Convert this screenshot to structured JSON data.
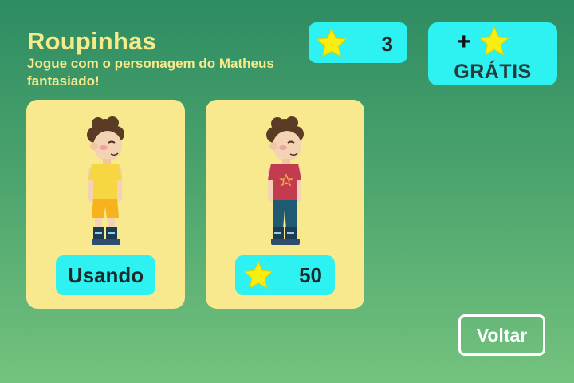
{
  "header": {
    "title": "Roupinhas",
    "subtitle": "Jogue com o personagem do Matheus fantasiado!"
  },
  "stars": {
    "count": "3",
    "icon": "star-icon"
  },
  "free_stars": {
    "plus": "+",
    "label": "GRÁTIS",
    "icon": "star-icon"
  },
  "outfits": [
    {
      "name": "yellow-outfit",
      "button_label": "Usando",
      "shirt_color": "#f6d641",
      "pants_color": "#f7b21e"
    },
    {
      "name": "red-outfit",
      "price": "50",
      "shirt_color": "#c33b4f",
      "pants_color": "#1f5a72"
    }
  ],
  "back_button": {
    "label": "Voltar"
  },
  "colors": {
    "accent": "#2ef2f2",
    "card": "#f8e88e",
    "title": "#f7ea8a",
    "star": "#f8ee0f"
  }
}
